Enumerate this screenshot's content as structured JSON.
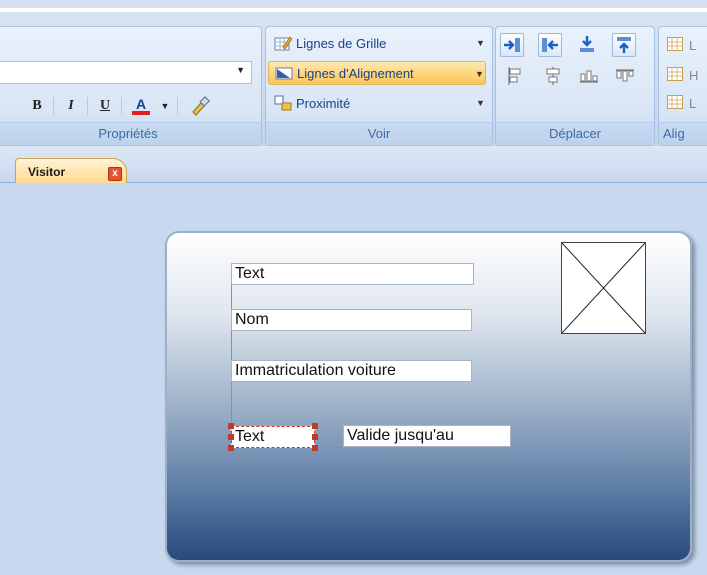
{
  "ribbon": {
    "groups": {
      "properties": {
        "label": "Propriétés"
      },
      "view": {
        "label": "Voir"
      },
      "move": {
        "label": "Déplacer"
      },
      "align": {
        "label": "Alig"
      }
    },
    "font_combo": {
      "value": ""
    },
    "format_buttons": [
      "B",
      "I",
      "U",
      "A"
    ],
    "view_items": {
      "grid_lines": "Lignes de Grille",
      "alignment_lines": "Lignes d'Alignement",
      "proximity": "Proximité"
    },
    "align_item_stubs": [
      "L",
      "H",
      "L"
    ]
  },
  "tabs": [
    {
      "label": "Visitor",
      "close": "x"
    }
  ],
  "card": {
    "fields": {
      "text_top": "Text",
      "name": "Nom",
      "plate": "Immatriculation voiture",
      "text_bottom": "Text",
      "valid_until": "Valide jusqu'au"
    }
  },
  "colors": {
    "accent_orange": "#e27a2c",
    "ribbon_text": "#15428b",
    "active_item": "#fdd680",
    "card_bottom": "#27497c"
  }
}
